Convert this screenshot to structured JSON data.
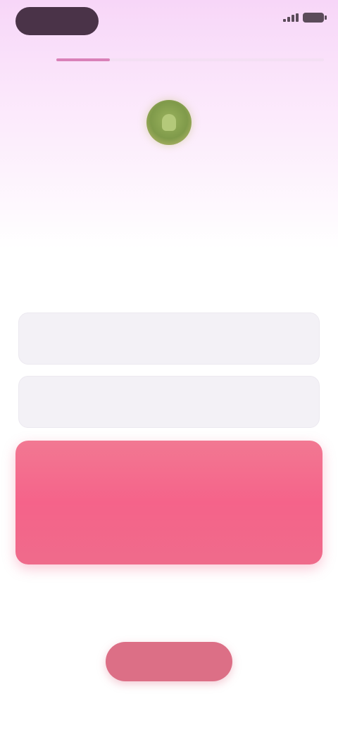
{
  "status_bar": {
    "time": "",
    "center_label": ""
  },
  "progress": {
    "fraction": 0.2
  },
  "header": {
    "title": "",
    "subtitle": ""
  },
  "form": {
    "field_1": {
      "label": "",
      "value": "",
      "placeholder": ""
    },
    "field_2": {
      "label": "",
      "value": "",
      "placeholder": ""
    }
  },
  "primary_button": {
    "label": ""
  },
  "secondary_button": {
    "label": ""
  },
  "colors": {
    "accent": "#f5638a",
    "secondary": "#dc6f86",
    "progress": "#d981b8",
    "logo": "#8fa853"
  },
  "icons": {
    "logo": "app-logo-icon",
    "signal": "signal-icon",
    "battery": "battery-icon"
  }
}
